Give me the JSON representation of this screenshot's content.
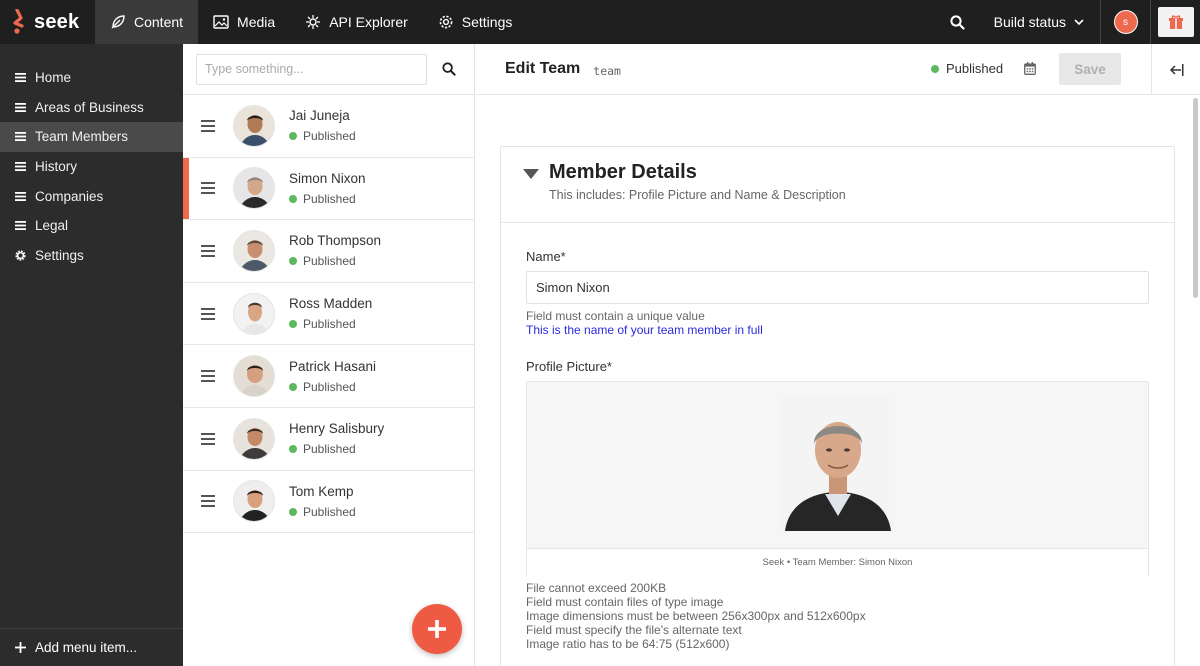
{
  "topbar": {
    "logo_text": "seek",
    "nav": [
      {
        "label": "Content",
        "icon": "feather-icon",
        "active": true
      },
      {
        "label": "Media",
        "icon": "image-icon",
        "active": false
      },
      {
        "label": "API Explorer",
        "icon": "api-icon",
        "active": false
      },
      {
        "label": "Settings",
        "icon": "gear-icon",
        "active": false
      }
    ],
    "build_status_label": "Build status",
    "user_initial": "s"
  },
  "sidebar": {
    "items": [
      {
        "label": "Home",
        "icon": "menu-icon",
        "active": false
      },
      {
        "label": "Areas of Business",
        "icon": "menu-icon",
        "active": false
      },
      {
        "label": "Team Members",
        "icon": "menu-icon",
        "active": true
      },
      {
        "label": "History",
        "icon": "menu-icon",
        "active": false
      },
      {
        "label": "Companies",
        "icon": "menu-icon",
        "active": false
      },
      {
        "label": "Legal",
        "icon": "menu-icon",
        "active": false
      },
      {
        "label": "Settings",
        "icon": "gear-icon",
        "active": false
      }
    ],
    "add_menu_label": "Add menu item..."
  },
  "list": {
    "search_placeholder": "Type something...",
    "entries": [
      {
        "name": "Jai Juneja",
        "status": "Published"
      },
      {
        "name": "Simon Nixon",
        "status": "Published",
        "selected": true
      },
      {
        "name": "Rob Thompson",
        "status": "Published"
      },
      {
        "name": "Ross Madden",
        "status": "Published"
      },
      {
        "name": "Patrick Hasani",
        "status": "Published"
      },
      {
        "name": "Henry Salisbury",
        "status": "Published"
      },
      {
        "name": "Tom Kemp",
        "status": "Published"
      }
    ]
  },
  "editor": {
    "title": "Edit Team",
    "type_label": "team",
    "status": "Published",
    "save_label": "Save",
    "section": {
      "title": "Member Details",
      "subtitle": "This includes: Profile Picture and Name & Description"
    },
    "name_field": {
      "label": "Name*",
      "value": "Simon Nixon",
      "hint": "Field must contain a unique value",
      "help": "This is the name of your team member in full"
    },
    "picture_field": {
      "label": "Profile Picture*",
      "caption": "Seek • Team Member: Simon Nixon",
      "rules": [
        "File cannot exceed 200KB",
        "Field must contain files of type image",
        "Image dimensions must be between 256x300px and 512x600px",
        "Field must specify the file's alternate text",
        "Image ratio has to be 64:75 (512x600)"
      ]
    }
  },
  "colors": {
    "accent": "#ee6a4f",
    "published": "#5cb85c",
    "topbar": "#1f1f1f",
    "sidebar": "#2c2c2c",
    "help_text": "#2a2ae0"
  }
}
